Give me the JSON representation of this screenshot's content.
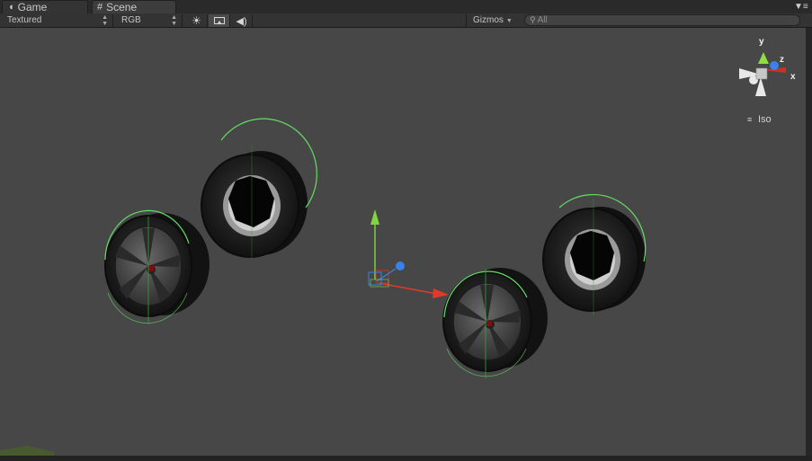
{
  "tabs": [
    {
      "label": "Game",
      "icon": "pacman-icon",
      "active": false
    },
    {
      "label": "Scene",
      "icon": "grid-icon",
      "active": true
    }
  ],
  "toolbar": {
    "render_mode": "Textured",
    "color_channel": "RGB",
    "gizmos_label": "Gizmos",
    "search_placeholder": "All",
    "lighting_icon": "sun-icon",
    "scene_view_icon": "image-icon",
    "audio_icon": "audio-icon"
  },
  "scene_gizmo": {
    "axes": {
      "y": "y",
      "z": "z",
      "x": "x"
    },
    "projection_label": "Iso"
  },
  "colors": {
    "viewport_bg": "#474747",
    "x_axis": "#e03a2a",
    "y_axis": "#7fd640",
    "z_axis": "#3a82e6",
    "collider": "#66dd66"
  }
}
